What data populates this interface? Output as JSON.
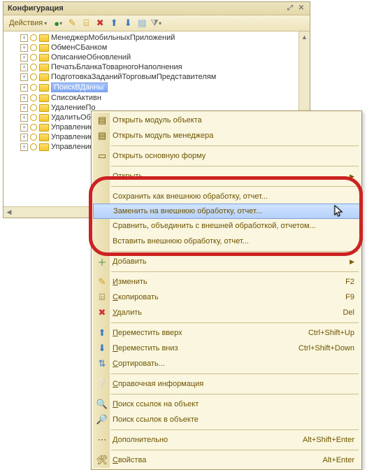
{
  "panel": {
    "title": "Конфигурация",
    "actions_label": "Действия"
  },
  "tree": {
    "items": [
      "МенеджерМобильныхПриложений",
      "ОбменСБанком",
      "ОписаниеОбновлений",
      "ПечатьБланкаТоварногоНаполнения",
      "ПодготовкаЗаданийТорговымПредставителям",
      "ПоискВДанны",
      "СписокАктивн",
      "УдалениеПо",
      "УдалитьОбр",
      "Управление",
      "Управление",
      "Управление"
    ],
    "selected_index": 5
  },
  "ctx": {
    "items": [
      {
        "label": "Открыть модуль объекта",
        "icon": "module-icon"
      },
      {
        "label": "Открыть модуль менеджера",
        "icon": "module-icon"
      },
      {
        "sep": true
      },
      {
        "label": "Открыть основную форму",
        "icon": "form-icon"
      },
      {
        "sep": true
      },
      {
        "label": "Открыть",
        "submenu": true
      },
      {
        "sep": true
      },
      {
        "label": "Сохранить как внешнюю обработку, отчет...",
        "group": true
      },
      {
        "label": "Заменить на внешнюю обработку, отчет...",
        "group": true,
        "hovered": true
      },
      {
        "label": "Сравнить, объединить с внешней обработкой, отчетом...",
        "group": true
      },
      {
        "label": "Вставить внешнюю обработку, отчет...",
        "group": true
      },
      {
        "sep": true
      },
      {
        "label": "Добавить",
        "icon": "add-icon",
        "submenu": true
      },
      {
        "sep": true
      },
      {
        "label": "Изменить",
        "icon": "edit-icon",
        "shortcut": "F2",
        "u": true
      },
      {
        "label": "Скопировать",
        "icon": "copy-icon",
        "shortcut": "F9",
        "u": true
      },
      {
        "label": "Удалить",
        "icon": "delete-icon",
        "shortcut": "Del",
        "u": true
      },
      {
        "sep": true
      },
      {
        "label": "Переместить вверх",
        "icon": "up-icon",
        "shortcut": "Ctrl+Shift+Up",
        "u": true
      },
      {
        "label": "Переместить вниз",
        "icon": "down-icon",
        "shortcut": "Ctrl+Shift+Down",
        "u": true
      },
      {
        "label": "Сортировать...",
        "icon": "sort-icon",
        "u": true
      },
      {
        "sep": true
      },
      {
        "label": "Справочная информация",
        "icon": "help-icon",
        "u": true
      },
      {
        "sep": true
      },
      {
        "label": "Поиск ссылок на объект",
        "icon": "search-obj-icon",
        "u": true
      },
      {
        "label": "Поиск ссылок в объекте",
        "icon": "search-in-icon"
      },
      {
        "sep": true
      },
      {
        "label": "Дополнительно",
        "icon": "extra-icon",
        "shortcut": "Alt+Shift+Enter",
        "u": true
      },
      {
        "sep": true
      },
      {
        "label": "Свойства",
        "icon": "props-icon",
        "shortcut": "Alt+Enter",
        "u": true
      }
    ]
  }
}
